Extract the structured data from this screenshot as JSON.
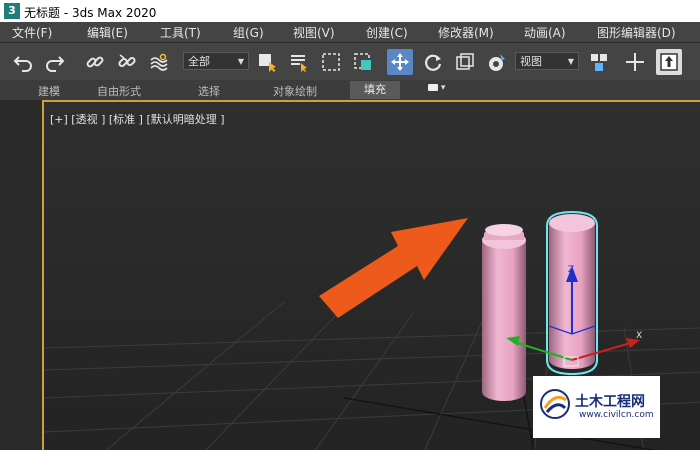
{
  "window": {
    "logo_text": "3",
    "title": "无标题 - 3ds Max 2020"
  },
  "menu": [
    "文件(F)",
    "编辑(E)",
    "工具(T)",
    "组(G)",
    "视图(V)",
    "创建(C)",
    "修改器(M)",
    "动画(A)",
    "图形编辑器(D)"
  ],
  "toolbar": {
    "selection_filter": "全部",
    "reference_coord": "视图"
  },
  "ribbon": {
    "tabs": [
      "建模",
      "自由形式",
      "选择",
      "对象绘制",
      "填充"
    ],
    "active_tab": "填充"
  },
  "viewport": {
    "label": "[+] [透视 ] [标准 ] [默认明暗处理 ]"
  },
  "gizmo": {
    "z_label": "Z",
    "x_label": "X"
  },
  "watermark": {
    "name": "土木工程网",
    "url": "www.civilcn.com"
  }
}
